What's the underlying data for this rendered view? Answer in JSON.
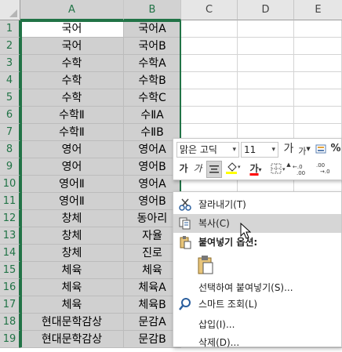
{
  "columns": [
    "A",
    "B",
    "C",
    "D",
    "E"
  ],
  "rows": [
    {
      "n": "1",
      "a": "국어",
      "b": "국어A"
    },
    {
      "n": "2",
      "a": "국어",
      "b": "국어B"
    },
    {
      "n": "3",
      "a": "수학",
      "b": "수학A"
    },
    {
      "n": "4",
      "a": "수학",
      "b": "수학B"
    },
    {
      "n": "5",
      "a": "수학",
      "b": "수학C"
    },
    {
      "n": "6",
      "a": "수학Ⅱ",
      "b": "수ⅡA"
    },
    {
      "n": "7",
      "a": "수학Ⅱ",
      "b": "수ⅡB"
    },
    {
      "n": "8",
      "a": "영어",
      "b": "영어A"
    },
    {
      "n": "9",
      "a": "영어",
      "b": "영어B"
    },
    {
      "n": "10",
      "a": "영어Ⅱ",
      "b": "영어A"
    },
    {
      "n": "11",
      "a": "영어Ⅱ",
      "b": "영어B"
    },
    {
      "n": "12",
      "a": "창체",
      "b": "동아리"
    },
    {
      "n": "13",
      "a": "창체",
      "b": "자율"
    },
    {
      "n": "14",
      "a": "창체",
      "b": "진로"
    },
    {
      "n": "15",
      "a": "체육",
      "b": "체육"
    },
    {
      "n": "16",
      "a": "체육",
      "b": "체육A"
    },
    {
      "n": "17",
      "a": "체육",
      "b": "체육B"
    },
    {
      "n": "18",
      "a": "현대문학감상",
      "b": "문감A"
    },
    {
      "n": "19",
      "a": "현대문학감상",
      "b": "문감B"
    }
  ],
  "mini_toolbar": {
    "font_name": "맑은 고딕",
    "font_size": "11",
    "increase_font": "가",
    "decrease_font": "가",
    "percent": "%",
    "bold": "가",
    "italic": "가",
    "font_color_letter": "가",
    "decimal_inc": "←.0\n.00",
    "decimal_dec": ".00\n→.0",
    "fill_color": "#ffff00",
    "font_color": "#ff0000"
  },
  "context_menu": {
    "items": [
      {
        "label": "잘라내기(T)",
        "icon": "scissors-icon"
      },
      {
        "label": "복사(C)",
        "icon": "copy-icon",
        "highlighted": true
      },
      {
        "label": "붙여넣기 옵션:",
        "icon": "paste-icon",
        "header": true
      },
      {
        "label": "",
        "icon": "paste-option-icon"
      },
      {
        "label": "선택하여 붙여넣기(S)...",
        "icon": ""
      },
      {
        "label": "스마트 조회(L)",
        "icon": "smart-lookup-icon"
      },
      {
        "label": "삽입(I)...",
        "icon": ""
      },
      {
        "label": "삭제(D)...",
        "icon": ""
      }
    ]
  },
  "colors": {
    "selection_accent": "#217346",
    "selected_cell_bg": "#d0d0d0"
  }
}
